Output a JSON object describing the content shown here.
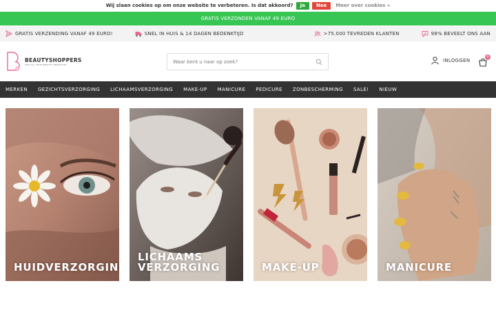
{
  "cookie": {
    "text": "Wij slaan cookies op om onze website te verbeteren. Is dat akkoord?",
    "yes": "Ja",
    "no": "Nee",
    "more": "Meer over cookies »"
  },
  "promo": {
    "text": "GRATIS VERZONDEN VANAF 49 EURO"
  },
  "usp": [
    {
      "icon": "send-icon",
      "text": "GRATIS VERZENDING VANAF 49 EURO!"
    },
    {
      "icon": "truck-icon",
      "text": "SNEL IN HUIS & 14 DAGEN BEDENKTIJD"
    },
    {
      "icon": "users-icon",
      "text": ">75.000 TEVREDEN KLANTEN"
    },
    {
      "icon": "chat-icon",
      "text": "98% BEVEELT ONS AAN"
    }
  ],
  "header": {
    "logo_name": "BEAUTYSHOPPERS",
    "logo_sub": "FOR ALL YOUR BEAUTY PRODUCTS",
    "search_placeholder": "Waar bent u naar op zoek?",
    "login": "INLOGGEN",
    "cart_count": "0"
  },
  "nav": [
    "MERKEN",
    "GEZICHTSVERZORGING",
    "LICHAAMSVERZORGING",
    "MAKE-UP",
    "MANICURE",
    "PEDICURE",
    "ZONBESCHERMING",
    "SALE!",
    "NIEUW"
  ],
  "tiles": [
    {
      "line1": "HUIDVERZORGING",
      "line2": ""
    },
    {
      "line1": "LICHAAMS",
      "line2": "VERZORGING"
    },
    {
      "line1": "MAKE-UP",
      "line2": ""
    },
    {
      "line1": "MANICURE",
      "line2": ""
    }
  ],
  "colors": {
    "accent_green": "#37c654",
    "nav_bg": "#333333",
    "brand_pink": "#e86a8c"
  }
}
